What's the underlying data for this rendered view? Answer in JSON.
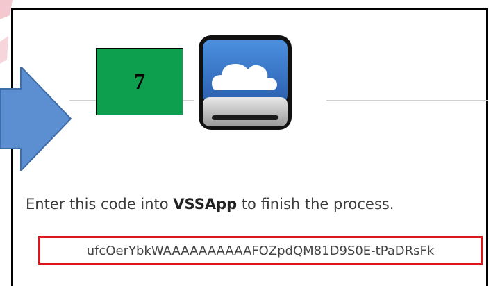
{
  "step": {
    "number": "7",
    "color": "#0d9f4e"
  },
  "icons": {
    "app": "cloud-drive-icon",
    "pointer": "right-arrow-icon"
  },
  "instruction": {
    "prefix": "Enter this code into ",
    "app_name": "VSSApp",
    "suffix": " to finish the process."
  },
  "code": {
    "value": "ufcOerYbkWAAAAAAAAAAFOZpdQM81D9S0E-tPaDRsFk",
    "highlight_color": "#e0141b"
  },
  "arrow_color": "#5b8fd1"
}
